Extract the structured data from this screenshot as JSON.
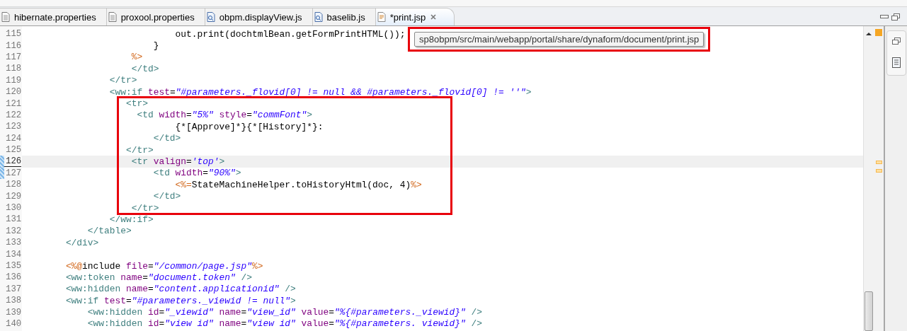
{
  "tabs": [
    {
      "label": "hibernate.properties",
      "kind": "text",
      "selected": false,
      "dirty": false
    },
    {
      "label": "proxool.properties",
      "kind": "text",
      "selected": false,
      "dirty": false
    },
    {
      "label": "obpm.displayView.js",
      "kind": "script",
      "selected": false,
      "dirty": false
    },
    {
      "label": "baselib.js",
      "kind": "script",
      "selected": false,
      "dirty": false
    },
    {
      "label": "*print.jsp",
      "kind": "page",
      "selected": true,
      "dirty": true
    }
  ],
  "tooltip": {
    "text": "sp8obpm/src/main/webapp/portal/share/dynaform/document/print.jsp",
    "highlighted": true
  },
  "blocks": [
    {
      "highlighted": false,
      "lines": [
        {
          "number": "115",
          "tokens": [
            {
              "kind": "text",
              "text": "                            out.print(dochtmlBean.getFormPrintHTML());"
            }
          ],
          "current": false,
          "changed": false
        },
        {
          "number": "116",
          "tokens": [
            {
              "kind": "text",
              "text": "                        }"
            }
          ],
          "current": false,
          "changed": false
        },
        {
          "number": "117",
          "tokens": [
            {
              "kind": "jsp",
              "text": "                    %>"
            }
          ],
          "current": false,
          "changed": false
        },
        {
          "number": "118",
          "tokens": [
            {
              "kind": "tag",
              "text": "                    </td>"
            }
          ],
          "current": false,
          "changed": false
        },
        {
          "number": "119",
          "tokens": [
            {
              "kind": "tag",
              "text": "                </tr>"
            }
          ],
          "current": false,
          "changed": false
        },
        {
          "number": "120",
          "tokens": [
            {
              "kind": "tag",
              "text": "                <ww:if"
            },
            {
              "kind": "attr",
              "text": " test"
            },
            {
              "kind": "text",
              "text": "="
            },
            {
              "kind": "str",
              "text": "\"#parameters._flovid[0] != null && #parameters._flovid[0] != ''\""
            },
            {
              "kind": "tag",
              "text": ">"
            }
          ],
          "current": false,
          "changed": false
        }
      ]
    },
    {
      "highlighted": true,
      "lines": [
        {
          "number": "121",
          "tokens": [
            {
              "kind": "tag",
              "text": "                   <tr>"
            }
          ],
          "current": false,
          "changed": false
        },
        {
          "number": "122",
          "tokens": [
            {
              "kind": "tag",
              "text": "                     <td"
            },
            {
              "kind": "attr",
              "text": " width"
            },
            {
              "kind": "text",
              "text": "="
            },
            {
              "kind": "str",
              "text": "\"5%\""
            },
            {
              "kind": "attr",
              "text": " style"
            },
            {
              "kind": "text",
              "text": "="
            },
            {
              "kind": "str",
              "text": "\"commFont\""
            },
            {
              "kind": "tag",
              "text": ">"
            }
          ],
          "current": false,
          "changed": false
        },
        {
          "number": "123",
          "tokens": [
            {
              "kind": "text",
              "text": "                            {*[Approve]*}{*[History]*}:"
            }
          ],
          "current": false,
          "changed": false
        },
        {
          "number": "124",
          "tokens": [
            {
              "kind": "tag",
              "text": "                        </td>"
            }
          ],
          "current": false,
          "changed": false
        },
        {
          "number": "125",
          "tokens": [
            {
              "kind": "tag",
              "text": "                   </tr>"
            }
          ],
          "current": false,
          "changed": false
        },
        {
          "number": "126",
          "tokens": [
            {
              "kind": "tag",
              "text": "                    <tr"
            },
            {
              "kind": "attr",
              "text": " valign"
            },
            {
              "kind": "text",
              "text": "="
            },
            {
              "kind": "str",
              "text": "'top'"
            },
            {
              "kind": "tag",
              "text": ">"
            }
          ],
          "current": true,
          "changed": true
        },
        {
          "number": "127",
          "tokens": [
            {
              "kind": "tag",
              "text": "                        <td"
            },
            {
              "kind": "attr",
              "text": " width"
            },
            {
              "kind": "text",
              "text": "="
            },
            {
              "kind": "str",
              "text": "\"90%\""
            },
            {
              "kind": "tag",
              "text": ">"
            }
          ],
          "current": false,
          "changed": true
        },
        {
          "number": "128",
          "tokens": [
            {
              "kind": "jsp",
              "text": "                            <%="
            },
            {
              "kind": "text",
              "text": "StateMachineHelper.toHistoryHtml(doc, 4)"
            },
            {
              "kind": "jsp",
              "text": "%>"
            }
          ],
          "current": false,
          "changed": false
        },
        {
          "number": "129",
          "tokens": [
            {
              "kind": "tag",
              "text": "                        </td>"
            }
          ],
          "current": false,
          "changed": false
        },
        {
          "number": "130",
          "tokens": [
            {
              "kind": "tag",
              "text": "                    </tr>"
            }
          ],
          "current": false,
          "changed": false
        }
      ]
    },
    {
      "highlighted": false,
      "lines": [
        {
          "number": "131",
          "tokens": [
            {
              "kind": "tag",
              "text": "                </ww:if>"
            }
          ],
          "current": false,
          "changed": false
        },
        {
          "number": "132",
          "tokens": [
            {
              "kind": "tag",
              "text": "            </table>"
            }
          ],
          "current": false,
          "changed": false
        },
        {
          "number": "133",
          "tokens": [
            {
              "kind": "tag",
              "text": "        </div>"
            }
          ],
          "current": false,
          "changed": false
        },
        {
          "number": "134",
          "current": false,
          "changed": false
        },
        {
          "number": "135",
          "tokens": [
            {
              "kind": "jsp",
              "text": "        <%@"
            },
            {
              "kind": "text",
              "text": "include"
            },
            {
              "kind": "attr",
              "text": " file"
            },
            {
              "kind": "text",
              "text": "="
            },
            {
              "kind": "str",
              "text": "\"/common/page.jsp\""
            },
            {
              "kind": "jsp",
              "text": "%>"
            }
          ],
          "current": false,
          "changed": false
        },
        {
          "number": "136",
          "tokens": [
            {
              "kind": "tag",
              "text": "        <ww:token"
            },
            {
              "kind": "attr",
              "text": " name"
            },
            {
              "kind": "text",
              "text": "="
            },
            {
              "kind": "str",
              "text": "\"document.token\""
            },
            {
              "kind": "tag",
              "text": " />"
            }
          ],
          "current": false,
          "changed": false
        },
        {
          "number": "137",
          "tokens": [
            {
              "kind": "tag",
              "text": "        <ww:hidden"
            },
            {
              "kind": "attr",
              "text": " name"
            },
            {
              "kind": "text",
              "text": "="
            },
            {
              "kind": "str",
              "text": "\"content.applicationid\""
            },
            {
              "kind": "tag",
              "text": " />"
            }
          ],
          "current": false,
          "changed": false
        },
        {
          "number": "138",
          "tokens": [
            {
              "kind": "tag",
              "text": "        <ww:if"
            },
            {
              "kind": "attr",
              "text": " test"
            },
            {
              "kind": "text",
              "text": "="
            },
            {
              "kind": "str",
              "text": "\"#parameters._viewid != null\""
            },
            {
              "kind": "tag",
              "text": ">"
            }
          ],
          "current": false,
          "changed": false
        },
        {
          "number": "139",
          "tokens": [
            {
              "kind": "tag",
              "text": "            <ww:hidden"
            },
            {
              "kind": "attr",
              "text": " id"
            },
            {
              "kind": "text",
              "text": "="
            },
            {
              "kind": "str",
              "text": "\"_viewid\""
            },
            {
              "kind": "attr",
              "text": " name"
            },
            {
              "kind": "text",
              "text": "="
            },
            {
              "kind": "str",
              "text": "\"view_id\""
            },
            {
              "kind": "attr",
              "text": " value"
            },
            {
              "kind": "text",
              "text": "="
            },
            {
              "kind": "str",
              "text": "\"%{#parameters._viewid}\""
            },
            {
              "kind": "tag",
              "text": " />"
            }
          ],
          "current": false,
          "changed": false
        },
        {
          "number": "140",
          "tokens": [
            {
              "kind": "tag",
              "text": "            <ww:hidden"
            },
            {
              "kind": "attr",
              "text": " id"
            },
            {
              "kind": "text",
              "text": "="
            },
            {
              "kind": "str",
              "text": "\"view id\""
            },
            {
              "kind": "attr",
              "text": " name"
            },
            {
              "kind": "text",
              "text": "="
            },
            {
              "kind": "str",
              "text": "\"view id\""
            },
            {
              "kind": "attr",
              "text": " value"
            },
            {
              "kind": "text",
              "text": "="
            },
            {
              "kind": "str",
              "text": "\"%{#parameters. viewid}\""
            },
            {
              "kind": "tag",
              "text": " />"
            }
          ],
          "current": false,
          "changed": false
        }
      ]
    }
  ]
}
